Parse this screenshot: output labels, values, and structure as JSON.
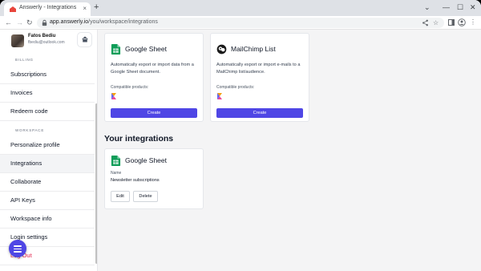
{
  "browser": {
    "tab_title": "Answerly - Integrations",
    "tab_close": "×",
    "new_tab": "+",
    "url_host": "app.answerly.io",
    "url_path": "/you/workspace/integrations",
    "back": "←",
    "forward": "→",
    "reload": "↻",
    "minimize": "—",
    "maximize": "☐",
    "close": "✕",
    "chevron": "⌄"
  },
  "user": {
    "name": "Fatos Bediu",
    "email": "fbediu@outlook.com"
  },
  "sidebar": {
    "billing_label": "BILLING",
    "workspace_label": "WORKSPACE",
    "billing_items": [
      "Subscriptions",
      "Invoices",
      "Redeem code"
    ],
    "workspace_items": [
      "Personalize profile",
      "Integrations",
      "Collaborate",
      "API Keys",
      "Workspace info",
      "Login settings"
    ],
    "logout": "Log Out",
    "active": "Integrations"
  },
  "available": [
    {
      "title": "Google Sheet",
      "description": "Automatically export or import data from a Google Sheet document.",
      "compatible_label": "Compatible products:",
      "button": "Create"
    },
    {
      "title": "MailChimp List",
      "description": "Automatically export or import e-mails to a MailChimp list/audience.",
      "compatible_label": "Compatible products:",
      "button": "Create"
    }
  ],
  "your_integrations": {
    "heading": "Your integrations",
    "items": [
      {
        "title": "Google Sheet",
        "name_label": "Name",
        "name_value": "Newsletter subscriptions",
        "edit": "Edit",
        "delete": "Delete"
      }
    ]
  },
  "colors": {
    "accent": "#4f46e5",
    "sheets_green": "#0f9d58",
    "logout_red": "#e11d48"
  }
}
